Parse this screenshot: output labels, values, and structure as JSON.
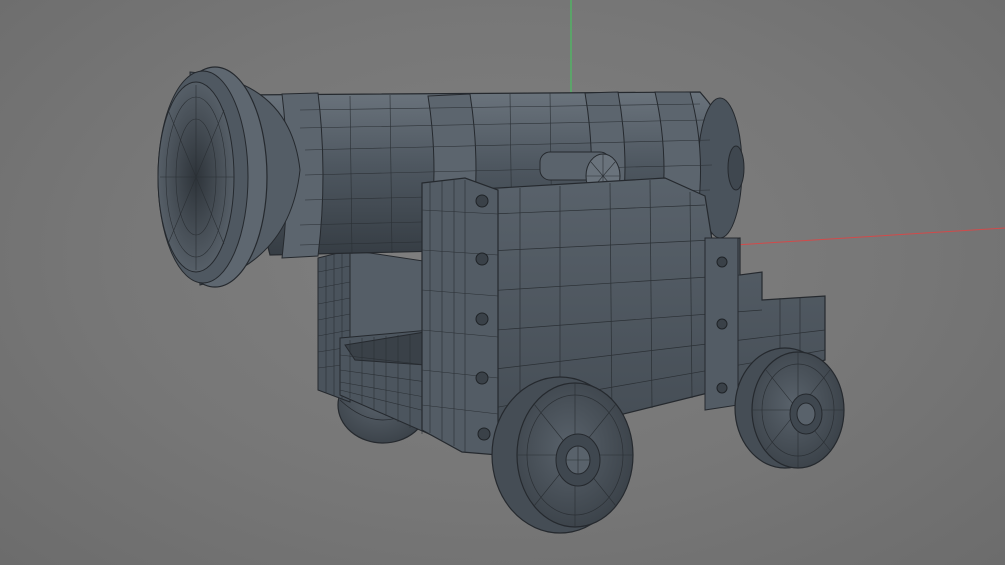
{
  "viewport": {
    "background": "#7a7a7a",
    "axis_colors": {
      "x": "#d24a4a",
      "y": "#3ecf5a"
    },
    "object": {
      "name": "cannon",
      "display": "wireframe-on-shaded",
      "material_color": "#4a535c",
      "edge_color": "#25292e",
      "parts": [
        "barrel",
        "muzzle",
        "trunnion",
        "carriage",
        "front-wheel",
        "rear-wheel",
        "bolts"
      ]
    }
  }
}
